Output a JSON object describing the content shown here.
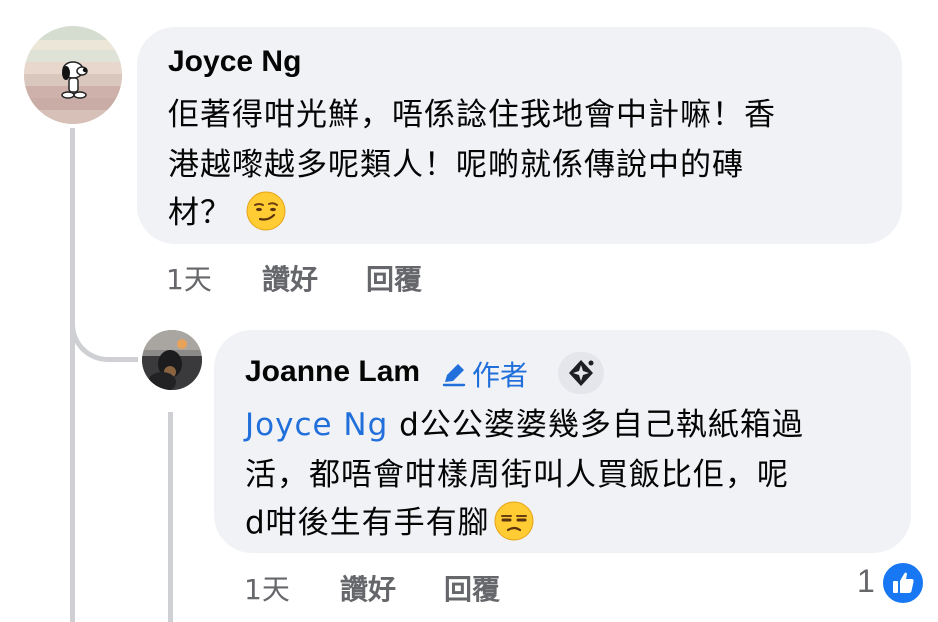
{
  "comments": [
    {
      "author": "Joyce Ng",
      "avatar_icon": "snoopy-avatar",
      "body_lines": [
        "佢著得咁光鮮，唔係諗住我地會中計嘛！香",
        "港越嚟越多呢類人！呢啲就係傳說中的磚",
        "材？"
      ],
      "emoji": "smirking-face-emoji",
      "time": "1天",
      "like_label": "讚好",
      "reply_label": "回覆"
    }
  ],
  "reply": {
    "author": "Joanne Lam",
    "author_badge": "作者",
    "badge_icon": "pencil-icon",
    "top_fan_icon": "sparkle-badge-icon",
    "avatar_icon": "dog-photo-avatar",
    "mention": "Joyce Ng",
    "body_lines": [
      " d公公婆婆幾多自己執紙箱過",
      "活，都唔會咁樣周街叫人買飯比佢，呢",
      "d咁後生有手有腳"
    ],
    "emoji": "unamused-face-emoji",
    "time": "1天",
    "like_label": "讚好",
    "reply_label": "回覆",
    "reaction_count": "1",
    "reaction_icon": "like-thumb-icon"
  },
  "colors": {
    "bubble": "#f0f2f5",
    "mention": "#216fdb",
    "meta": "#65676b",
    "like": "#1877f2"
  }
}
